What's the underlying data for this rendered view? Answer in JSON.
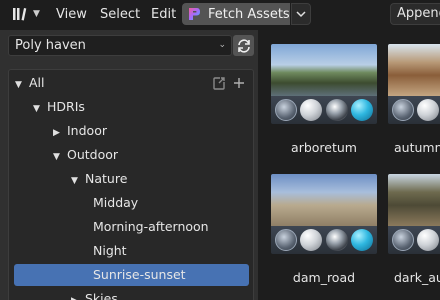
{
  "header": {
    "menus": [
      "View",
      "Select",
      "Edit"
    ],
    "fetch_label": "Fetch Assets",
    "append_label": "Append"
  },
  "left_panel": {
    "source_value": "Poly haven",
    "tree": [
      {
        "label": "All",
        "depth": 0,
        "expanded": true
      },
      {
        "label": "HDRIs",
        "depth": 1,
        "expanded": true
      },
      {
        "label": "Indoor",
        "depth": 2,
        "expanded": false
      },
      {
        "label": "Outdoor",
        "depth": 2,
        "expanded": true
      },
      {
        "label": "Nature",
        "depth": 3,
        "expanded": true
      },
      {
        "label": "Midday",
        "depth": 4
      },
      {
        "label": "Morning-afternoon",
        "depth": 4
      },
      {
        "label": "Night",
        "depth": 4
      },
      {
        "label": "Sunrise-sunset",
        "depth": 4,
        "selected": true
      },
      {
        "label": "Skies",
        "depth": 3,
        "expanded": false
      }
    ]
  },
  "assets": [
    {
      "name": "arboretum"
    },
    {
      "name": "autumn_f"
    },
    {
      "name": "dam_road"
    },
    {
      "name": "dark_autu"
    }
  ],
  "colors": {
    "selection": "#4772b3",
    "button": "#545454",
    "panel": "#303030",
    "background": "#1d1d1d"
  }
}
